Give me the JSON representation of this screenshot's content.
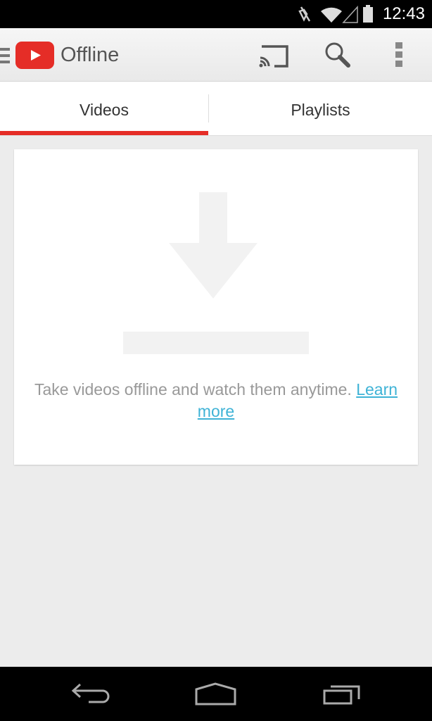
{
  "status_bar": {
    "time": "12:43",
    "icons": [
      "mute-icon",
      "wifi-icon",
      "signal-icon",
      "battery-icon"
    ]
  },
  "action_bar": {
    "title": "Offline",
    "icons": [
      "menu-icon",
      "youtube-logo",
      "cast-icon",
      "search-icon",
      "overflow-menu-icon"
    ]
  },
  "tabs": [
    {
      "label": "Videos",
      "selected": true
    },
    {
      "label": "Playlists",
      "selected": false
    }
  ],
  "empty_state": {
    "icon": "download-icon",
    "message": "Take videos offline and watch them anytime.",
    "link": "Learn more"
  },
  "nav_bar": {
    "icons": [
      "back-icon",
      "home-icon",
      "recents-icon"
    ]
  },
  "colors": {
    "accent": "#e52d27",
    "link": "#3fb3d6"
  }
}
